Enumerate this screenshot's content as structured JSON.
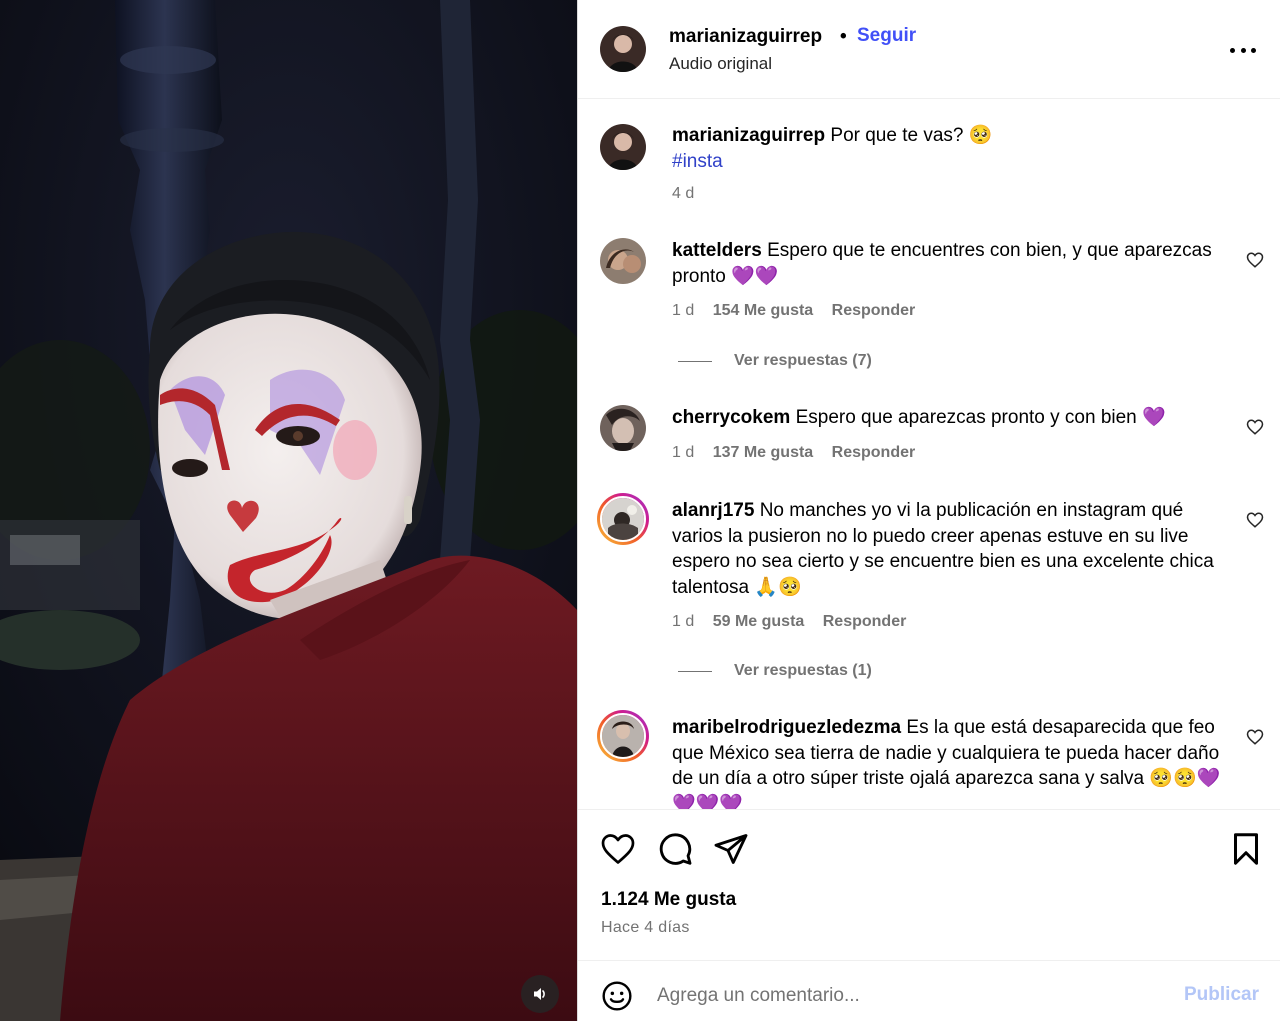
{
  "post": {
    "author": "marianizaguirrep",
    "separator": "•",
    "follow_label": "Seguir",
    "audio": "Audio original",
    "more_icon": "more-horizontal-icon",
    "mute_icon": "speaker-icon"
  },
  "caption": {
    "username": "marianizaguirrep",
    "text": "Por que te vas? 🥺",
    "hashtag": "#insta",
    "time": "4 d"
  },
  "comments": [
    {
      "username": "kattelders",
      "text": "Espero que te encuentres con bien, y que aparezcas pronto 💜💜",
      "time": "1 d",
      "likes": "154 Me gusta",
      "reply": "Responder",
      "view_replies": "Ver respuestas (7)"
    },
    {
      "username": "cherrycokem",
      "text": "Espero que aparezcas pronto y con bien 💜",
      "time": "1 d",
      "likes": "137 Me gusta",
      "reply": "Responder"
    },
    {
      "username": "alanrj175",
      "text": "No manches yo vi la publicación en instagram qué varios la pusieron no lo puedo creer apenas estuve en su live espero no sea cierto y se encuentre bien es una excelente chica talentosa 🙏🥺",
      "time": "1 d",
      "likes": "59 Me gusta",
      "reply": "Responder",
      "view_replies": "Ver respuestas (1)"
    },
    {
      "username": "maribelrodriguezledezma",
      "text": "Es la que está desaparecida que feo que México sea tierra de nadie y cualquiera te pueda hacer daño de un día a otro súper triste ojalá aparezca sana y salva 🥺🥺💜💜💜💜"
    }
  ],
  "actions": {
    "like_icon": "heart-icon",
    "comment_icon": "comment-bubble-icon",
    "share_icon": "paper-plane-icon",
    "save_icon": "bookmark-icon",
    "likes": "1.124 Me gusta",
    "posted": "Hace 4 días"
  },
  "composer": {
    "emoji_icon": "emoji-smiley-icon",
    "placeholder": "Agrega un comentario...",
    "publish_label": "Publicar"
  },
  "colors": {
    "link_blue": "#4150f7",
    "hashtag_blue": "#3041c8",
    "muted_text": "#737373",
    "publish_disabled": "#b3c6f7",
    "story_ring": [
      "#f9c33a",
      "#f0592a",
      "#d01c8c",
      "#9a3bd1"
    ]
  }
}
